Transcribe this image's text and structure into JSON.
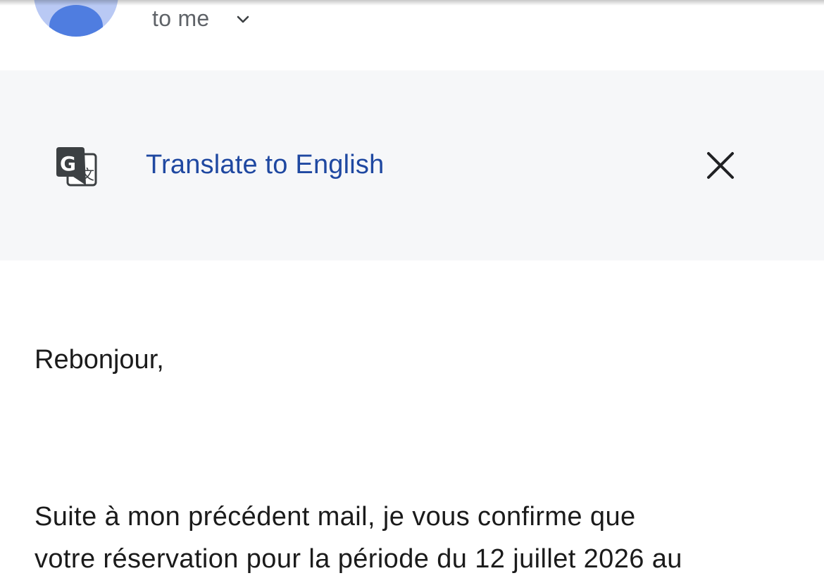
{
  "header": {
    "recipient_label": "to me",
    "avatar_icon": "person-avatar-icon",
    "chevron_icon": "chevron-down-icon"
  },
  "translate_banner": {
    "icon": "google-translate-icon",
    "link_label": "Translate to English",
    "close_icon": "close-icon",
    "link_color": "#1f48a1",
    "background": "#f6f7f9"
  },
  "email": {
    "greeting": "Rebonjour,",
    "paragraph_lines": [
      "Suite à mon précédent mail, je vous confirme que",
      "votre réservation pour la période du 12 juillet 2026 au"
    ]
  }
}
